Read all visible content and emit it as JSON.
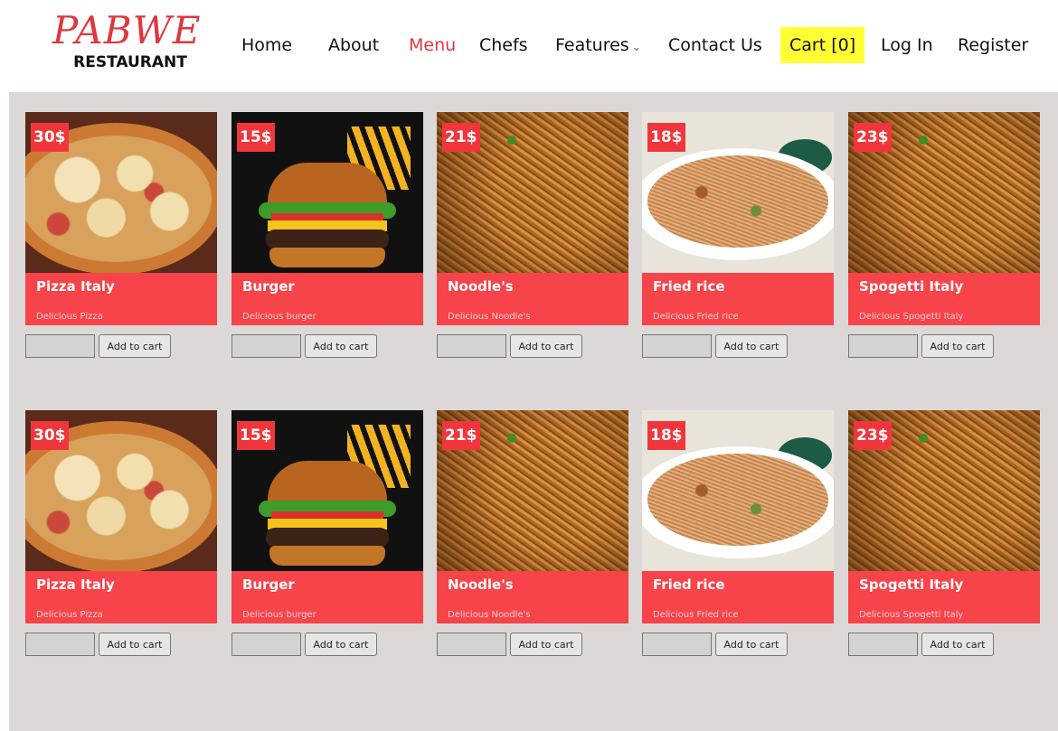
{
  "brand": {
    "name": "PABWE",
    "sub": "RESTAURANT"
  },
  "nav": {
    "home": "Home",
    "about": "About",
    "menu": "Menu",
    "chefs": "Chefs",
    "features": "Features",
    "contact": "Contact Us",
    "cart": "Cart [0]",
    "login": "Log In",
    "register": "Register"
  },
  "colors": {
    "accent": "#f7434a",
    "brand": "#e0363d",
    "cart_highlight": "#ffff33",
    "background": "#dcd8d8"
  },
  "add_to_cart_label": "Add to cart",
  "menu_items": [
    {
      "price": "30$",
      "name": "Pizza Italy",
      "desc": "Delicious Pizza",
      "image": "pizza"
    },
    {
      "price": "15$",
      "name": "Burger",
      "desc": "Delicious burger",
      "image": "burger"
    },
    {
      "price": "21$",
      "name": "Noodle's",
      "desc": "Delicious Noodle's",
      "image": "noodles"
    },
    {
      "price": "18$",
      "name": "Fried rice",
      "desc": "Delicious Fried rice",
      "image": "rice"
    },
    {
      "price": "23$",
      "name": "Spogetti Italy",
      "desc": "Delicious Spogetti Italy",
      "image": "noodles"
    },
    {
      "price": "30$",
      "name": "Pizza Italy",
      "desc": "Delicious Pizza",
      "image": "pizza"
    },
    {
      "price": "15$",
      "name": "Burger",
      "desc": "Delicious burger",
      "image": "burger"
    },
    {
      "price": "21$",
      "name": "Noodle's",
      "desc": "Delicious Noodle's",
      "image": "noodles"
    },
    {
      "price": "18$",
      "name": "Fried rice",
      "desc": "Delicious Fried rice",
      "image": "rice"
    },
    {
      "price": "23$",
      "name": "Spogetti Italy",
      "desc": "Delicious Spogetti Italy",
      "image": "noodles"
    }
  ]
}
